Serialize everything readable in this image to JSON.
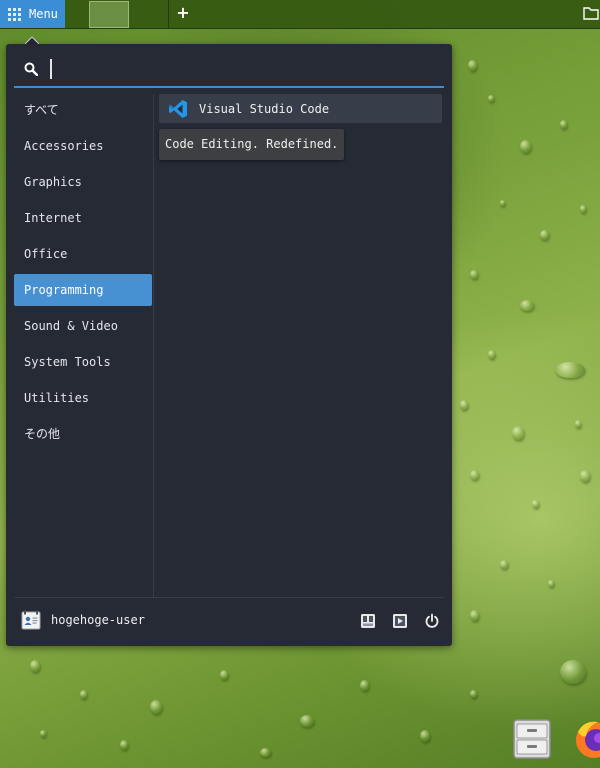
{
  "panel": {
    "menu_label": "Menu",
    "add_label": "+"
  },
  "menu": {
    "search": {
      "value": "",
      "placeholder": ""
    },
    "categories": [
      {
        "label": "すべて"
      },
      {
        "label": "Accessories"
      },
      {
        "label": "Graphics"
      },
      {
        "label": "Internet"
      },
      {
        "label": "Office"
      },
      {
        "label": "Programming",
        "selected": true
      },
      {
        "label": "Sound & Video"
      },
      {
        "label": "System Tools"
      },
      {
        "label": "Utilities"
      },
      {
        "label": "その他"
      }
    ],
    "apps": [
      {
        "name": "Visual Studio Code",
        "icon": "vscode-icon",
        "tooltip": "Code Editing. Redefined."
      }
    ],
    "user": {
      "name": "hogehoge-user"
    },
    "actions": [
      {
        "icon": "lock-screen-icon"
      },
      {
        "icon": "logout-icon"
      },
      {
        "icon": "power-icon"
      }
    ]
  },
  "desktop": {
    "dock": [
      {
        "icon": "file-cabinet-icon"
      },
      {
        "icon": "firefox-icon"
      }
    ]
  },
  "colors": {
    "accent": "#3b8ed4",
    "menu_bg": "#252a35",
    "selected_bg": "#4791d2",
    "item_bg": "#373d49"
  }
}
